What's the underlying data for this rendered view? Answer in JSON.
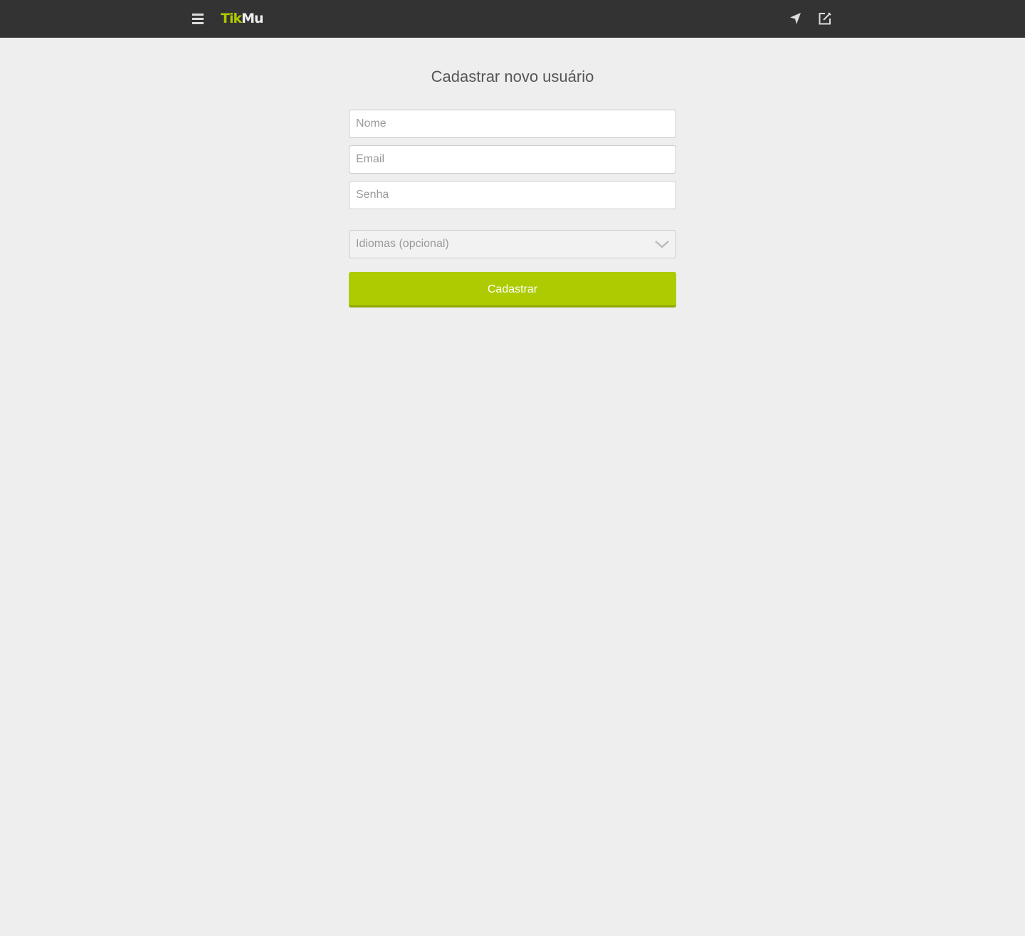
{
  "header": {
    "logo_part1": "Tik",
    "logo_part2": "Mu",
    "menu_icon": "hamburger-menu-icon",
    "location_icon": "location-arrow-icon",
    "compose_icon": "edit-compose-icon"
  },
  "form": {
    "title": "Cadastrar novo usuário",
    "name_placeholder": "Nome",
    "email_placeholder": "Email",
    "password_placeholder": "Senha",
    "languages_placeholder": "Idiomas (opcional)",
    "submit_label": "Cadastrar"
  },
  "colors": {
    "accent": "#adcb00",
    "topbar": "#333333",
    "background": "#eeeeee"
  }
}
